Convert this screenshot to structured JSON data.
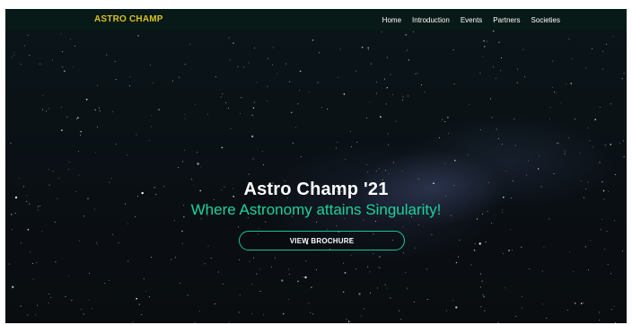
{
  "navbar": {
    "logo_text": "ASTRO CHAMP",
    "links": [
      {
        "label": "Home"
      },
      {
        "label": "Introduction"
      },
      {
        "label": "Events"
      },
      {
        "label": "Partners"
      },
      {
        "label": "Societies"
      }
    ]
  },
  "hero": {
    "title": "Astro Champ '21",
    "tagline": "Where Astronomy attains Singularity!",
    "button_label": "VIEW BROCHURE"
  },
  "colors": {
    "navbar_bg": "#071a17",
    "logo": "#d8c026",
    "accent": "#1bd39a",
    "sky_bg": "#0a1216"
  }
}
